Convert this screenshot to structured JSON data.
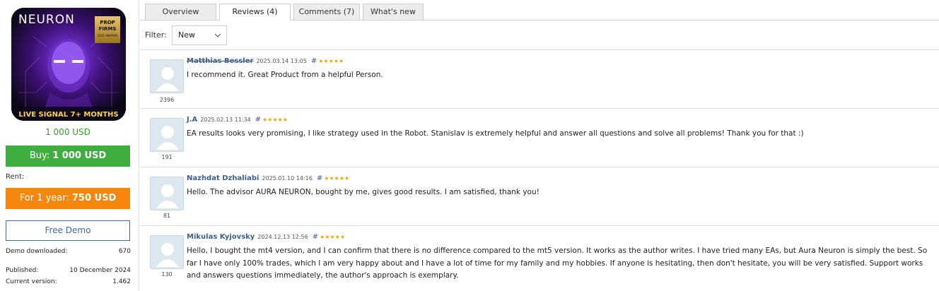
{
  "product": {
    "image_title": "NEURON",
    "badge_line1": "PROP",
    "badge_line2": "FIRMS",
    "badge_line3": "2025 AWARDS",
    "image_banner": "LIVE SIGNAL 7+ MONTHS",
    "price": "1 000 USD",
    "buy_prefix": "Buy: ",
    "buy_amount": "1 000 USD",
    "rent_label": "Rent:",
    "rent_prefix": "For 1 year: ",
    "rent_amount": "750 USD",
    "demo_label": "Free Demo",
    "demo_downloaded_label": "Demo downloaded:",
    "demo_downloaded_value": "670",
    "published_label": "Published:",
    "published_value": "10 December 2024",
    "version_label": "Current version:",
    "version_value": "1.462"
  },
  "tabs": [
    {
      "label": "Overview"
    },
    {
      "label": "Reviews (4)"
    },
    {
      "label": "Comments (7)"
    },
    {
      "label": "What's new"
    }
  ],
  "filter": {
    "label": "Filter:",
    "selected": "New"
  },
  "reviews": [
    {
      "author": "Matthias Bessler",
      "date": "2025.03.14 13:05",
      "hash": "#",
      "stars": "★★★★★",
      "rating_count": "2396",
      "text": "I recommend it. Great Product from a helpful Person."
    },
    {
      "author": "J.A",
      "date": "2025.02.13 11:34",
      "hash": "#",
      "stars": "★★★★★",
      "rating_count": "191",
      "text": "EA results looks very promising, I like strategy used in the Robot. Stanislav is extremely helpful and answer all questions and solve all problems! Thank you for that :)"
    },
    {
      "author": "Nazhdat Dzhaliabi",
      "date": "2025.01.10 14:16",
      "hash": "#",
      "stars": "★★★★★",
      "rating_count": "81",
      "text": "Hello. The advisor AURA NEURON, bought by me, gives good results. I am satisfied, thank you!"
    },
    {
      "author": "Mikulas Kyjovsky",
      "date": "2024.12.13 12:56",
      "hash": "#",
      "stars": "★★★★★",
      "rating_count": "130",
      "text": "Hello, I bought the mt4 version, and I can confirm that there is no difference compared to the mt5 version. It works as the author writes. I have tried many EAs, but Aura Neuron is simply the best. So far I have only 100% trades, which I am very happy about and I have a lot of time for my family and my hobbies. If anyone is hesitating, then don't hesitate, you will be very satisfied. Support works and answers questions immediately, the author's approach is exemplary."
    }
  ],
  "colors": {
    "buy": "#3fae3f",
    "rent": "#f5870e",
    "link": "#3d5f8f",
    "star": "#f0a500",
    "price": "#3a9a2e"
  }
}
